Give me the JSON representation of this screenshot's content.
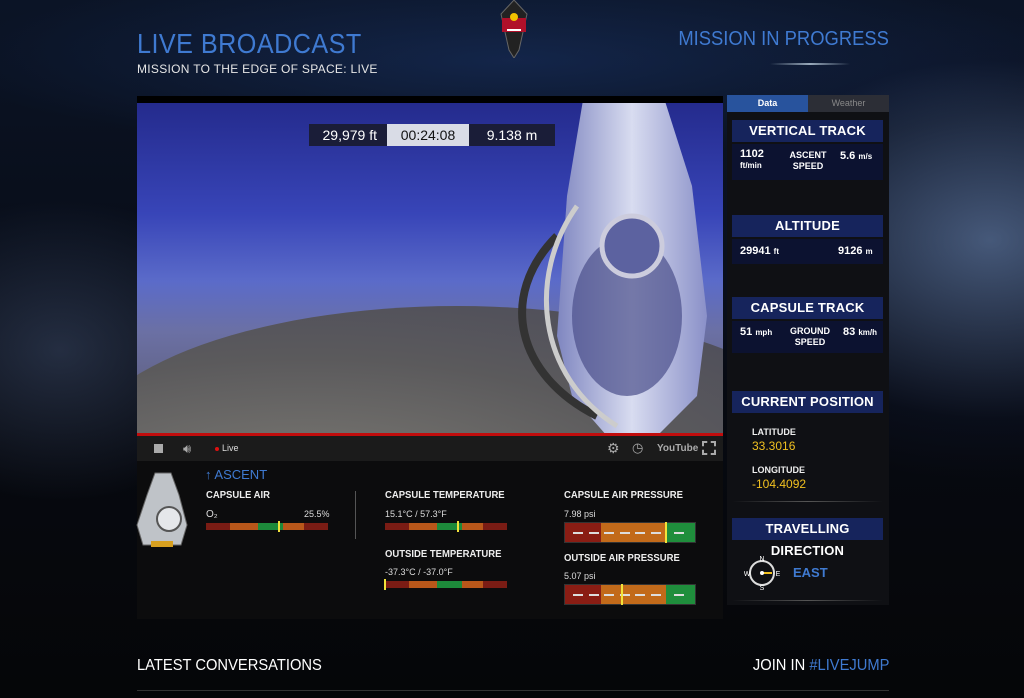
{
  "header": {
    "title": "LIVE BROADCAST",
    "subtitle": "MISSION TO THE EDGE OF SPACE: LIVE",
    "status": "MISSION IN PROGRESS"
  },
  "video": {
    "overlay": {
      "altitude_ft": "29,979 ft",
      "elapsed": "00:24:08",
      "altitude_m": "9.138 m"
    },
    "live_label": "Live",
    "youtube_label": "YouTube"
  },
  "telemetry": {
    "ascent_label": "ASCENT",
    "capsule_air": {
      "label": "CAPSULE AIR",
      "o2_label": "O₂",
      "o2_value": "25.5%",
      "o2_marker": 0.6
    },
    "capsule_temp": {
      "label": "CAPSULE TEMPERATURE",
      "value": "15.1°C / 57.3°F",
      "marker": 0.6
    },
    "outside_temp": {
      "label": "OUTSIDE TEMPERATURE",
      "value": "-37.3°C / -37.0°F",
      "marker": 0.0
    },
    "capsule_pressure": {
      "label": "CAPSULE AIR PRESSURE",
      "value": "7.98 psi",
      "marker": 0.78
    },
    "outside_pressure": {
      "label": "OUTSIDE AIR PRESSURE",
      "value": "5.07 psi",
      "marker": 0.44
    }
  },
  "panel": {
    "tabs": [
      {
        "label": "Data",
        "active": true
      },
      {
        "label": "Weather",
        "active": false
      }
    ],
    "vertical_track": {
      "title": "VERTICAL TRACK",
      "ft_value": "1102",
      "ft_unit": "ft/min",
      "label_line1": "ASCENT",
      "label_line2": "SPEED",
      "ms_value": "5.6",
      "ms_unit": "m/s"
    },
    "altitude": {
      "title": "ALTITUDE",
      "ft_value": "29941",
      "ft_unit": "ft",
      "m_value": "9126",
      "m_unit": "m"
    },
    "capsule_track": {
      "title": "CAPSULE TRACK",
      "mph_value": "51",
      "mph_unit": "mph",
      "label_line1": "GROUND",
      "label_line2": "SPEED",
      "kmh_value": "83",
      "kmh_unit": "km/h"
    },
    "position": {
      "title": "CURRENT POSITION",
      "lat_label": "LATITUDE",
      "lat_value": "33.3016",
      "lon_label": "LONGITUDE",
      "lon_value": "-104.4092"
    },
    "direction": {
      "title": "TRAVELLING DIRECTION",
      "value": "EAST",
      "n": "N",
      "s": "S",
      "e": "E",
      "w": "W"
    }
  },
  "footer": {
    "latest": "LATEST CONVERSATIONS",
    "join_prefix": "JOIN IN ",
    "join_tag": "#LIVEJUMP"
  },
  "colors": {
    "accent_blue": "#3f7ad1",
    "header_navy": "#16245c",
    "marker_yellow": "#f2e23a",
    "value_gold": "#f0c020"
  }
}
